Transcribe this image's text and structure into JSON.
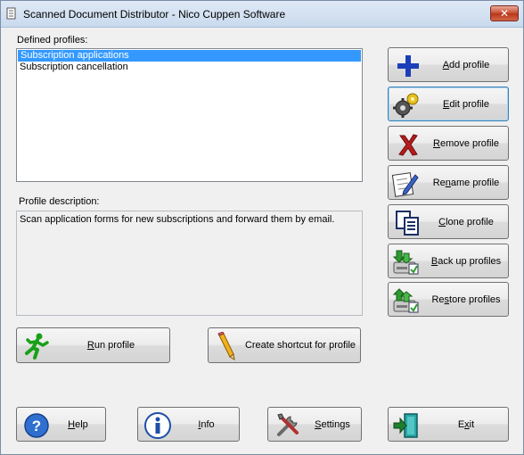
{
  "window": {
    "title": "Scanned Document Distributor - Nico Cuppen Software",
    "close": "✕"
  },
  "profiles": {
    "label": "Defined profiles:",
    "items": [
      {
        "label": "Subscription applications",
        "selected": true
      },
      {
        "label": "Subscription cancellation",
        "selected": false
      }
    ]
  },
  "description": {
    "label": "Profile description:",
    "text": "Scan application forms for new subscriptions and forward them by email."
  },
  "side_buttons": {
    "add": {
      "mn": "A",
      "rest": "dd profile"
    },
    "edit": {
      "mn": "E",
      "rest": "dit profile"
    },
    "remove": {
      "mn": "R",
      "rest": "emove profile"
    },
    "rename": {
      "pre": "Re",
      "mn": "n",
      "rest": "ame profile"
    },
    "clone": {
      "mn": "C",
      "rest": "lone profile"
    },
    "backup": {
      "mn": "B",
      "rest": "ack up profiles"
    },
    "restore": {
      "pre": "Re",
      "mn": "s",
      "rest": "tore profiles"
    }
  },
  "actions": {
    "run": {
      "mn": "R",
      "rest": "un profile"
    },
    "shortcut": {
      "label": "Create shortcut for profile"
    }
  },
  "bottom": {
    "help": {
      "mn": "H",
      "rest": "elp"
    },
    "info": {
      "mn": "I",
      "rest": "nfo"
    },
    "settings": {
      "mn": "S",
      "rest": "ettings"
    },
    "exit": {
      "pre": "E",
      "mn": "x",
      "rest": "it"
    }
  },
  "colors": {
    "selection": "#3399ff",
    "title_bg": "#c9daee",
    "close_red": "#c64a2e"
  }
}
